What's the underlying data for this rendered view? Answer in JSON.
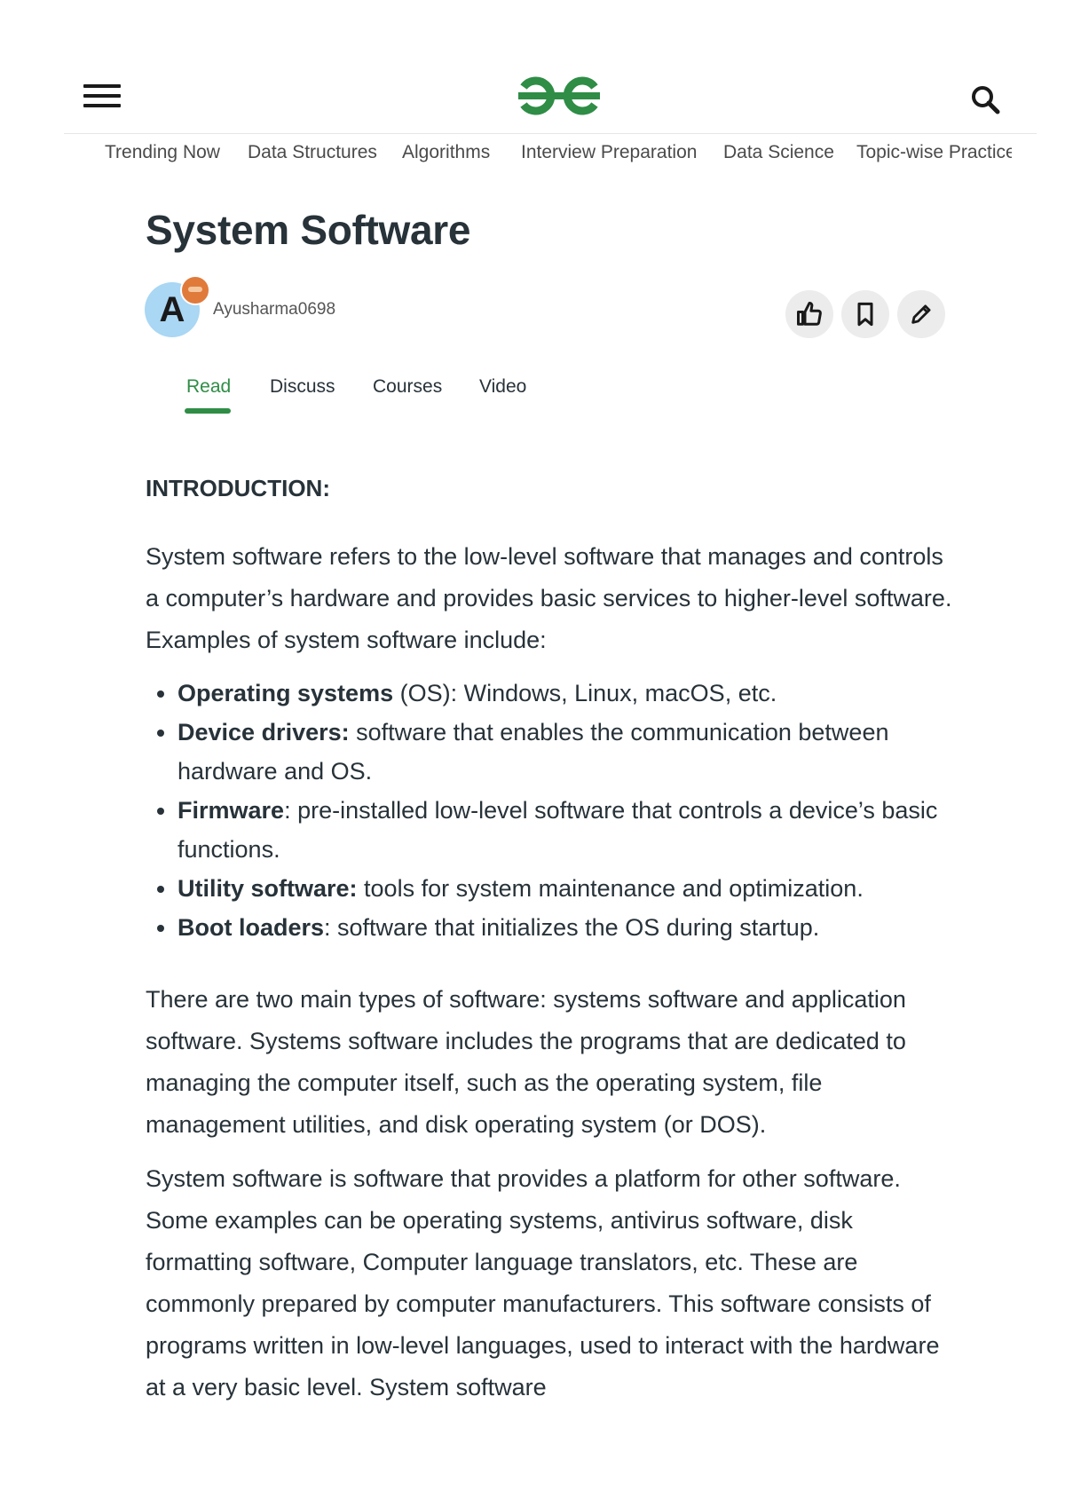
{
  "header": {
    "logo_alt": "GeeksforGeeks logo",
    "brand_color": "#2f8d46"
  },
  "nav": {
    "items": [
      "Trending Now",
      "Data Structures",
      "Algorithms",
      "Interview Preparation",
      "Data Science",
      "Topic-wise Practice"
    ]
  },
  "article": {
    "title": "System Software",
    "author": {
      "initial": "A",
      "name": "Ayusharma0698"
    },
    "tabs": [
      "Read",
      "Discuss",
      "Courses",
      "Video"
    ],
    "active_tab": "Read",
    "intro_heading": "INTRODUCTION:",
    "intro_paragraph": "System software refers to the low-level software that manages and controls a computer’s hardware and provides basic services to higher-level software. Examples of system software include:",
    "list": [
      {
        "term": "Operating systems",
        "text": " (OS): Windows, Linux, macOS, etc."
      },
      {
        "term": "Device drivers:",
        "text": " software that enables the communication between hardware and OS."
      },
      {
        "term": "Firmware",
        "text": ": pre-installed low-level software that controls a device’s basic functions."
      },
      {
        "term": "Utility software:",
        "text": " tools for system maintenance and optimization."
      },
      {
        "term": "Boot loaders",
        "text": ": software that initializes the OS during startup."
      }
    ],
    "paragraph_2": "There are two main types of software: systems software and application software. Systems software includes the programs that are dedicated to managing the computer itself, such as the operating system, file management utilities, and disk operating system (or DOS).",
    "paragraph_3": "System software is software that provides a platform for other software. Some examples can be operating systems, antivirus software, disk formatting software, Computer language translators, etc. These are commonly prepared by computer manufacturers. This software consists of programs written in low-level languages, used to interact with the hardware at a very basic level. System software"
  },
  "icons": {
    "menu": "hamburger-menu-icon",
    "search": "search-icon",
    "like": "thumbs-up-icon",
    "bookmark": "bookmark-icon",
    "edit": "pencil-icon"
  }
}
